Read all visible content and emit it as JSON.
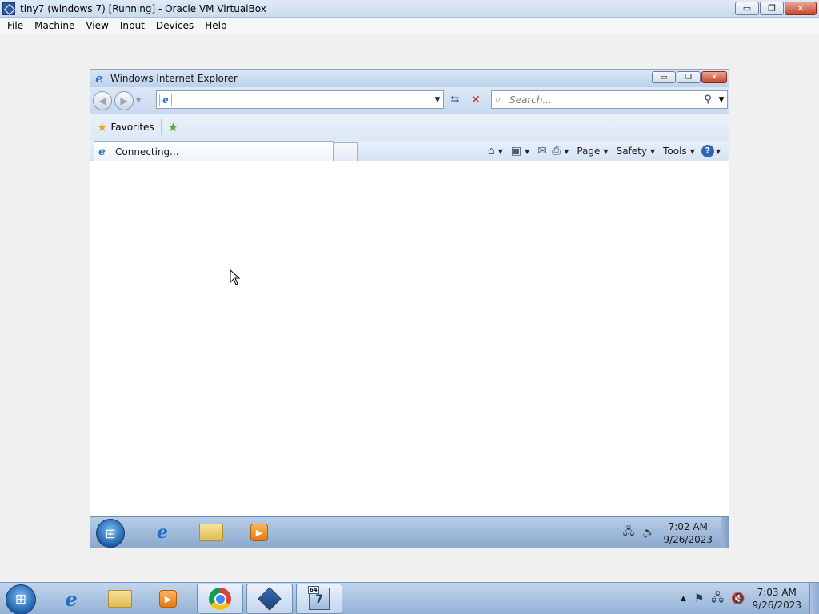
{
  "host": {
    "window_title": "tiny7 (windows 7) [Running] - Oracle VM VirtualBox",
    "window_buttons": {
      "minimize": "▭",
      "restore": "❐",
      "close": "✕"
    },
    "menu": [
      "File",
      "Machine",
      "View",
      "Input",
      "Devices",
      "Help"
    ],
    "taskbar": {
      "apps": [
        "start-orb-icon",
        "internet-explorer-icon",
        "windows-explorer-icon",
        "media-player-icon",
        "chrome-icon",
        "virtualbox-icon",
        "vm-windows7-icon"
      ],
      "vm_tag": "64",
      "vm_label": "7",
      "clock_time": "7:03 AM",
      "clock_date": "9/26/2023"
    }
  },
  "ie": {
    "title": "Windows Internet Explorer",
    "address_value": "",
    "search_placeholder": "Search...",
    "favorites_label": "Favorites",
    "tab_label": "Connecting...",
    "commands": {
      "page": "Page",
      "safety": "Safety",
      "tools": "Tools"
    }
  },
  "guest_taskbar": {
    "apps": [
      "start-orb-icon",
      "internet-explorer-icon",
      "windows-explorer-icon",
      "media-player-icon"
    ],
    "clock_time": "7:02 AM",
    "clock_date": "9/26/2023"
  },
  "colors": {
    "titlebar": "#cbdcee",
    "taskbar": "#94b2d6",
    "close_button": "#c7452c"
  }
}
